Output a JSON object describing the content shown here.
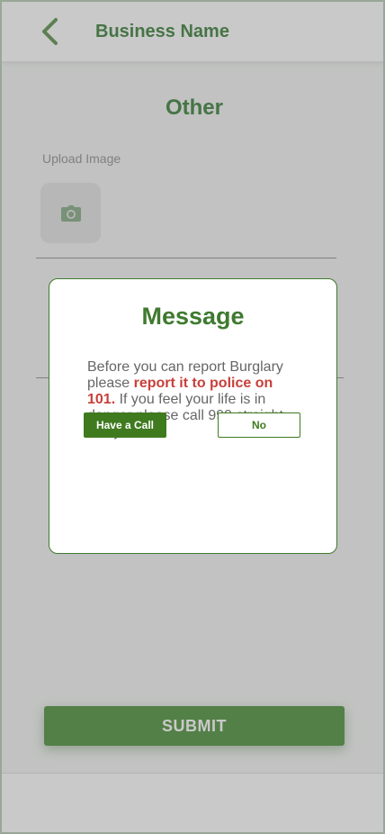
{
  "header": {
    "title": "Business Name",
    "back_icon": "chevron-left-icon"
  },
  "form": {
    "section_title": "Other",
    "upload_label": "Upload Image",
    "upload_icon": "camera-icon",
    "submit_label": "SUBMIT"
  },
  "modal": {
    "title": "Message",
    "text_before": "Before you can report Burglary please ",
    "text_highlight": "report it to police on 101.",
    "text_after": " If you feel your life is in danger please call 999 straight away",
    "call_button": "Have a Call",
    "no_button": "No"
  },
  "colors": {
    "brand_green": "#3f7a2f",
    "highlight_red": "#c8403a"
  }
}
